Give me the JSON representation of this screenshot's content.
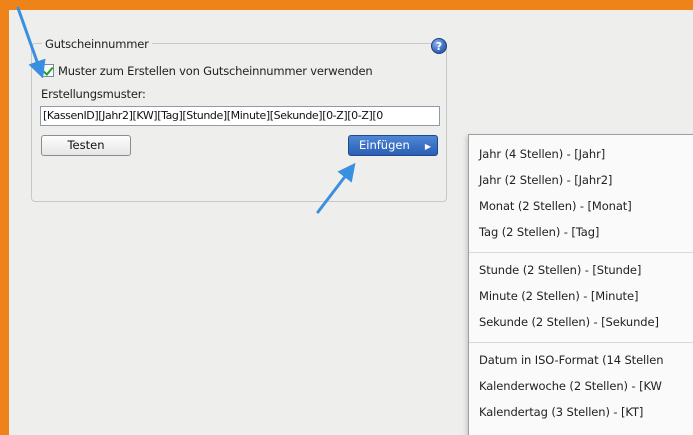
{
  "group": {
    "title": "Gutscheinnummer",
    "help_icon": "?"
  },
  "checkbox": {
    "label": "Muster zum Erstellen von Gutscheinnummer verwenden",
    "checked": true
  },
  "pattern": {
    "label": "Erstellungsmuster:",
    "value": "[KassenID][Jahr2][KW][Tag][Stunde][Minute][Sekunde][0-Z][0-Z][0"
  },
  "buttons": {
    "test_label": "Testen",
    "insert_label": "Einfügen"
  },
  "menu": {
    "groups": [
      [
        "Jahr (4 Stellen) - [Jahr]",
        "Jahr (2 Stellen) - [Jahr2]",
        "Monat (2 Stellen) - [Monat]",
        "Tag (2 Stellen) - [Tag]"
      ],
      [
        "Stunde (2 Stellen) - [Stunde]",
        "Minute (2 Stellen) - [Minute]",
        "Sekunde (2 Stellen) - [Sekunde]"
      ],
      [
        "Datum in ISO-Format (14 Stellen",
        "Kalenderwoche (2 Stellen) - [KW",
        "Kalendertag (3 Stellen) - [KT]"
      ]
    ]
  },
  "colors": {
    "frame": "#ee8419",
    "annotation_arrow": "#3b8fe0"
  }
}
